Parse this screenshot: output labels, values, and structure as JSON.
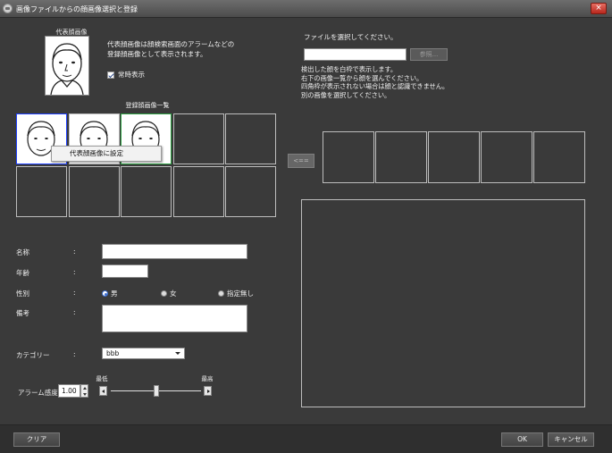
{
  "window": {
    "title": "画像ファイルからの顔画像選択と登録",
    "close_label": "×"
  },
  "representative": {
    "heading": "代表顔画像",
    "description": [
      "代表顔画像は顔検索画面のアラームなどの",
      "登録顔画像として表示されます。"
    ],
    "always_show_label": "常時表示",
    "always_show_checked": true
  },
  "registered": {
    "heading": "登録顔画像一覧",
    "context_menu_item": "代表顔画像に設定"
  },
  "form": {
    "name_label": "名称",
    "age_label": "年齢",
    "gender_label": "性別",
    "note_label": "備考",
    "category_label": "カテゴリー",
    "colon": ":",
    "gender_options": [
      "男",
      "女",
      "指定無し"
    ],
    "gender_selected": "男",
    "category_value": "bbb",
    "alarm_label": "アラーム感度",
    "alarm_value": "1.00",
    "slider_min_label": "最低",
    "slider_max_label": "最高",
    "slider_level": 0.5
  },
  "file": {
    "prompt": "ファイルを選択してください。",
    "browse_label": "参照...",
    "info_lines": [
      "検出した顔を白枠で表示します。",
      "右下の画像一覧から顔を選んでください。",
      "四角枠が表示されない場合は顔と認識できません。",
      "別の画像を選択してください。"
    ],
    "move_button": "<=="
  },
  "buttons": {
    "clear": "クリア",
    "ok": "OK",
    "cancel": "キャンセル"
  }
}
